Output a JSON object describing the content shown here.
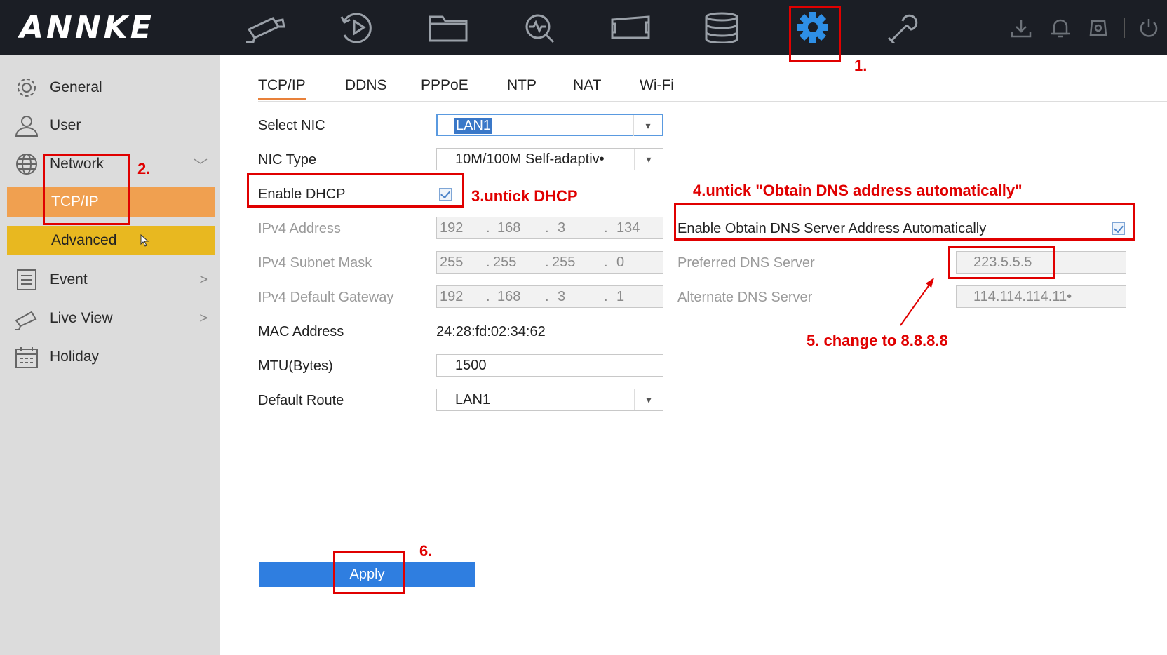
{
  "app": {
    "brand": "ANNKE"
  },
  "topnav": {
    "icons": [
      "live-view-camera-icon",
      "playback-icon",
      "file-folder-icon",
      "smart-analysis-icon",
      "camera-management-icon",
      "storage-icon",
      "configuration-gear-icon",
      "maintenance-wrench-icon"
    ],
    "right_icons": [
      "download-icon",
      "alarm-bell-icon",
      "backup-icon",
      "power-icon"
    ]
  },
  "sidebar": {
    "items": [
      {
        "label": "General",
        "icon": "gear-icon"
      },
      {
        "label": "User",
        "icon": "user-icon"
      },
      {
        "label": "Network",
        "icon": "globe-icon",
        "arrow": "﹀"
      },
      {
        "label": "Event",
        "icon": "event-icon",
        "arrow": ">"
      },
      {
        "label": "Live View",
        "icon": "camera-icon",
        "arrow": ">"
      },
      {
        "label": "Holiday",
        "icon": "calendar-icon"
      }
    ],
    "sub_tcpip": "TCP/IP",
    "sub_advanced": "Advanced"
  },
  "tabs": [
    "TCP/IP",
    "DDNS",
    "PPPoE",
    "NTP",
    "NAT",
    "Wi-Fi"
  ],
  "form": {
    "select_nic_label": "Select NIC",
    "select_nic_value": "LAN1",
    "nic_type_label": "NIC Type",
    "nic_type_value": "10M/100M Self-adaptiv•",
    "dhcp_label": "Enable DHCP",
    "ipv4_address_label": "IPv4 Address",
    "ipv4_address": [
      "192",
      "168",
      "3",
      "134"
    ],
    "ipv4_mask_label": "IPv4 Subnet Mask",
    "ipv4_mask": [
      "255",
      "255",
      "255",
      "0"
    ],
    "ipv4_gateway_label": "IPv4 Default Gateway",
    "ipv4_gateway": [
      "192",
      "168",
      "3",
      "1"
    ],
    "mac_label": "MAC Address",
    "mac_value": "24:28:fd:02:34:62",
    "mtu_label": "MTU(Bytes)",
    "mtu_value": "1500",
    "route_label": "Default Route",
    "route_value": "LAN1",
    "dns_auto_label": "Enable Obtain DNS Server Address Automatically",
    "pref_dns_label": "Preferred DNS Server",
    "pref_dns_value": "223.5.5.5",
    "alt_dns_label": "Alternate DNS Server",
    "alt_dns_value": "114.114.114.11•",
    "apply_label": "Apply"
  },
  "annotations": {
    "a1": "1.",
    "a2": "2.",
    "a3": "3.untick DHCP",
    "a4": "4.untick \"Obtain DNS address automatically\"",
    "a5": "5. change to 8.8.8.8",
    "a6": "6."
  },
  "colors": {
    "topbar": "#1b1e25",
    "selected": "#f0a050",
    "advanced": "#e8b820",
    "apply": "#2f7ee0",
    "annotation": "#e00000"
  }
}
